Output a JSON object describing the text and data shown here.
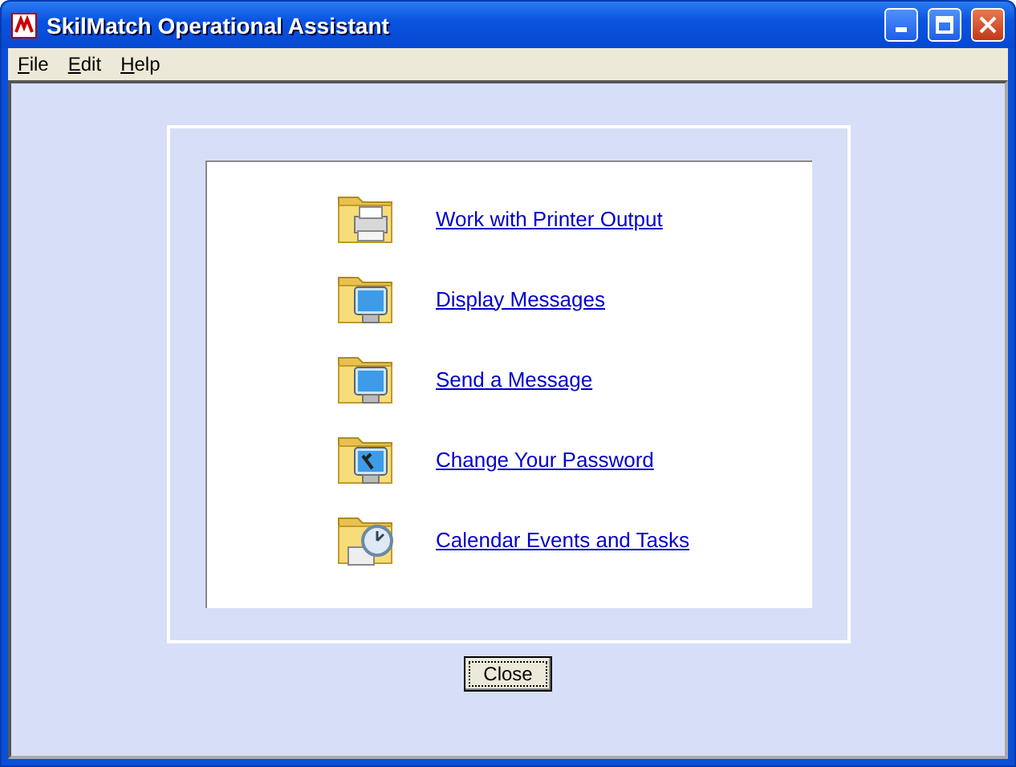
{
  "window": {
    "title": "SkilMatch Operational Assistant"
  },
  "menu": [
    "File",
    "Edit",
    "Help"
  ],
  "tasks": [
    {
      "kind": "printer",
      "label": "Work with Printer Output"
    },
    {
      "kind": "monitor",
      "label": "Display Messages"
    },
    {
      "kind": "monitor",
      "label": "Send a Message"
    },
    {
      "kind": "tools",
      "label": "Change Your Password"
    },
    {
      "kind": "calendar",
      "label": "Calendar Events and Tasks"
    }
  ],
  "buttons": [
    "Close"
  ]
}
